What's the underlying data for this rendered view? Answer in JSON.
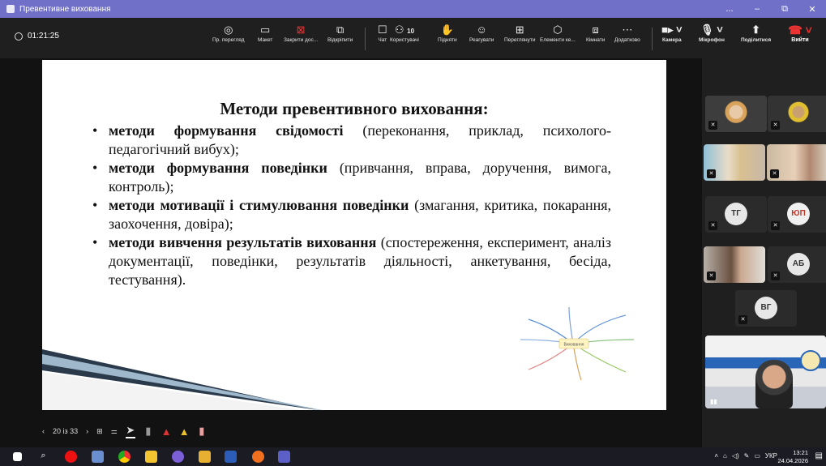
{
  "window": {
    "title": "Превентивне виховання",
    "controls": [
      "...",
      "–",
      "⧉",
      "✕"
    ]
  },
  "toolbar": {
    "timer": "01:21:25",
    "buttons": [
      {
        "icon": "eye-icon",
        "label": "Пр. перегляд"
      },
      {
        "icon": "layout-icon",
        "label": "Макет"
      },
      {
        "icon": "close-share-icon",
        "label": "Закрити дос..."
      },
      {
        "icon": "popout-icon",
        "label": "Відкріпити"
      },
      {
        "icon": "chat-icon",
        "label": "Чат"
      },
      {
        "icon": "people-icon",
        "label": "Користувачі",
        "count": "10"
      },
      {
        "icon": "raise-hand-icon",
        "label": "Підняти"
      },
      {
        "icon": "react-icon",
        "label": "Реагувати"
      },
      {
        "icon": "view-icon",
        "label": "Переглянути"
      },
      {
        "icon": "apps-icon",
        "label": "Елементи ке..."
      },
      {
        "icon": "rooms-icon",
        "label": "Кімнати"
      },
      {
        "icon": "more-icon",
        "label": "Додатково"
      },
      {
        "icon": "camera-icon",
        "label": "Камера"
      },
      {
        "icon": "mic-icon",
        "label": "Мікрофон"
      },
      {
        "icon": "share-icon",
        "label": "Поділитися"
      }
    ],
    "leave_label": "Вийти"
  },
  "slide": {
    "title": "Методи превентивного виховання:",
    "items": [
      {
        "bold": "методи формування свідомості",
        "rest": " (переконання, приклад, психолого-педагогічний вибух);"
      },
      {
        "bold": "методи формування поведінки",
        "rest": " (привчання, вправа, доручення, вимога, контроль);"
      },
      {
        "bold": "методи мотивації і стимулювання поведінки",
        "rest": " (змагання, критика, покарання, заохочення, довіра);"
      },
      {
        "bold": "методи вивчення результатів виховання",
        "rest": " (спостереження, експеримент, аналіз документації, поведінки, результатів діяльності, анкетування, бесіда, тестування)."
      }
    ],
    "mindmap_center": "Виховання"
  },
  "presenter_toolbar": {
    "page": "20 із 33"
  },
  "participants": [
    {
      "type": "photo",
      "muted": true
    },
    {
      "type": "photo",
      "muted": true
    },
    {
      "type": "photo",
      "muted": true
    },
    {
      "type": "photo",
      "muted": true
    },
    {
      "type": "initials",
      "initials": "ТГ",
      "muted": true
    },
    {
      "type": "initials",
      "initials": "ЮП",
      "muted": true,
      "color": "#c0392b"
    },
    {
      "type": "photo",
      "muted": true
    },
    {
      "type": "initials",
      "initials": "АБ",
      "muted": true
    },
    {
      "type": "initials",
      "initials": "ВГ",
      "muted": true
    }
  ],
  "taskbar": {
    "lang": "УКР",
    "time": "13:21",
    "date": "24.04.2026"
  },
  "colors": {
    "titlebar": "#7070c8",
    "leave": "#e33333",
    "slide_bg": "#ffffff"
  }
}
